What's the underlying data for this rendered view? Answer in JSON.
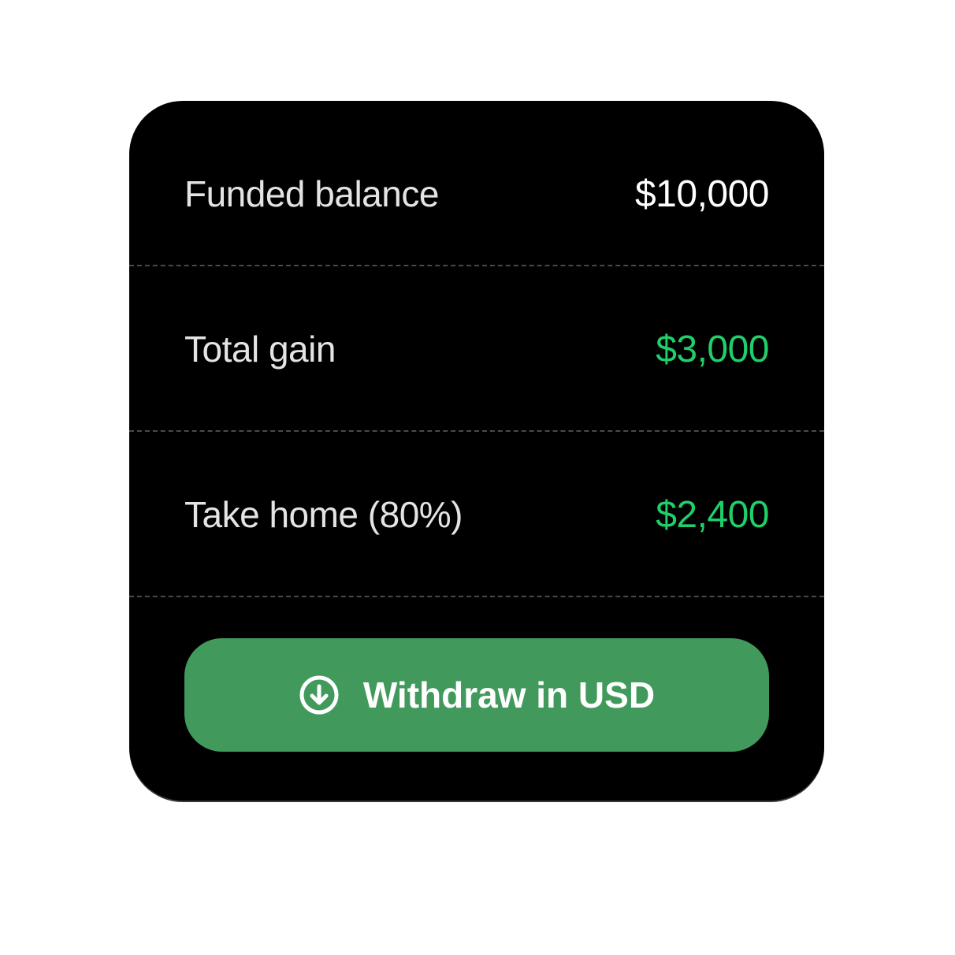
{
  "card": {
    "rows": [
      {
        "label": "Funded balance",
        "value": "$10,000",
        "value_color": "#ffffff"
      },
      {
        "label": "Total gain",
        "value": "$3,000",
        "value_color": "#1fd06a"
      },
      {
        "label": "Take home (80%)",
        "value": "$2,400",
        "value_color": "#1fd06a"
      }
    ],
    "withdraw_button": {
      "label": "Withdraw in USD",
      "icon": "arrow-down-circle-icon",
      "color": "#419a5c"
    }
  },
  "colors": {
    "card_background": "#000000",
    "page_background": "#ffffff",
    "accent_green": "#1fd06a"
  }
}
